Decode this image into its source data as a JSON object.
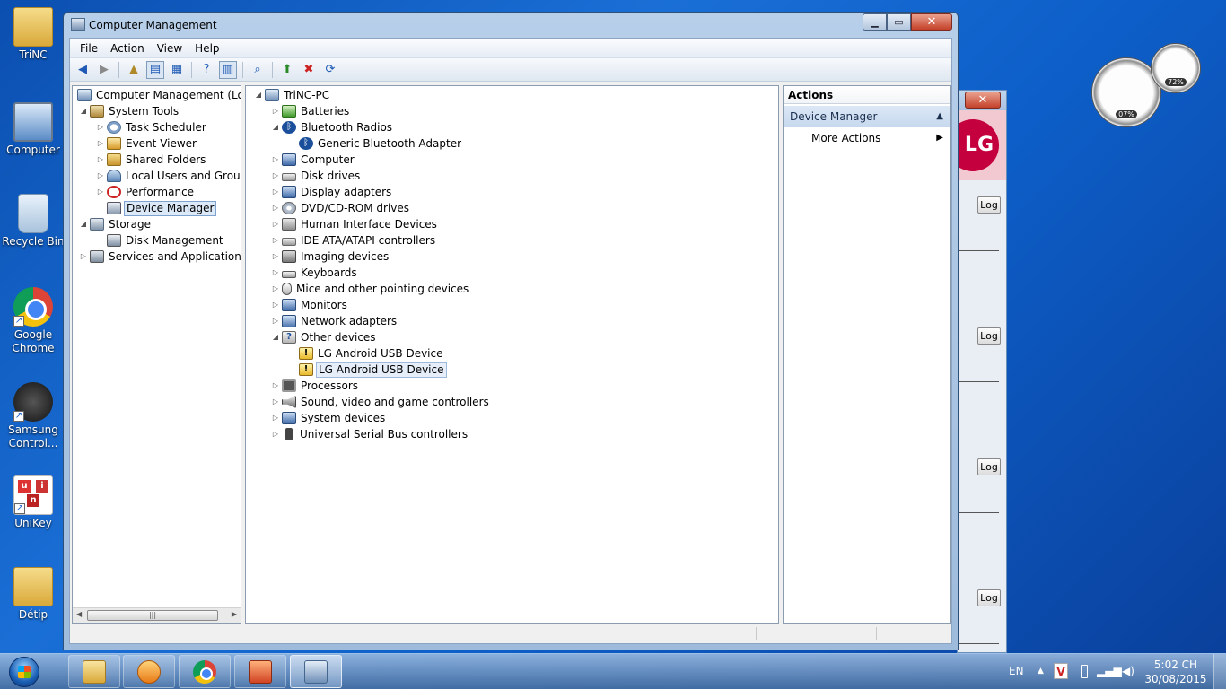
{
  "desktop_icons": [
    {
      "label": "TriNC",
      "icon": "user-folder-icon"
    },
    {
      "label": "Computer",
      "icon": "computer-icon"
    },
    {
      "label": "Recycle Bin",
      "icon": "recycle-bin-icon"
    },
    {
      "label": "Google Chrome",
      "icon": "chrome-icon"
    },
    {
      "label": "Samsung Control...",
      "icon": "samsung-control-icon"
    },
    {
      "label": "UniKey",
      "icon": "unikey-icon"
    },
    {
      "label": "Détip",
      "icon": "folder-icon"
    }
  ],
  "gadget": {
    "cpu": "07%",
    "ram": "72%"
  },
  "bg_window": {
    "close_label": "✕",
    "logo_text": "LG",
    "log_buttons": [
      "Log",
      "Log",
      "Log",
      "Log"
    ]
  },
  "window": {
    "title": "Computer Management",
    "minimize": "▁",
    "maximize": "▭",
    "close": "✕",
    "menu": [
      "File",
      "Action",
      "View",
      "Help"
    ]
  },
  "left_tree": {
    "root": "Computer Management (Local",
    "system_tools": "System Tools",
    "task_scheduler": "Task Scheduler",
    "event_viewer": "Event Viewer",
    "shared_folders": "Shared Folders",
    "local_users": "Local Users and Groups",
    "performance": "Performance",
    "device_manager": "Device Manager",
    "storage": "Storage",
    "disk_management": "Disk Management",
    "services": "Services and Applications"
  },
  "devices": {
    "root": "TriNC-PC",
    "batteries": "Batteries",
    "bluetooth": "Bluetooth Radios",
    "bt_adapter": "Generic Bluetooth Adapter",
    "computer": "Computer",
    "disk_drives": "Disk drives",
    "display": "Display adapters",
    "dvd": "DVD/CD-ROM drives",
    "hid": "Human Interface Devices",
    "ide": "IDE ATA/ATAPI controllers",
    "imaging": "Imaging devices",
    "keyboards": "Keyboards",
    "mice": "Mice and other pointing devices",
    "monitors": "Monitors",
    "network": "Network adapters",
    "other": "Other devices",
    "lg1": "LG Android USB Device",
    "lg2": "LG Android USB Device",
    "processors": "Processors",
    "sound": "Sound, video and game controllers",
    "system": "System devices",
    "usb": "Universal Serial Bus controllers"
  },
  "actions": {
    "header": "Actions",
    "group": "Device Manager",
    "more": "More Actions"
  },
  "taskbar": {
    "lang": "EN",
    "time": "5:02 CH",
    "date": "30/08/2015"
  }
}
